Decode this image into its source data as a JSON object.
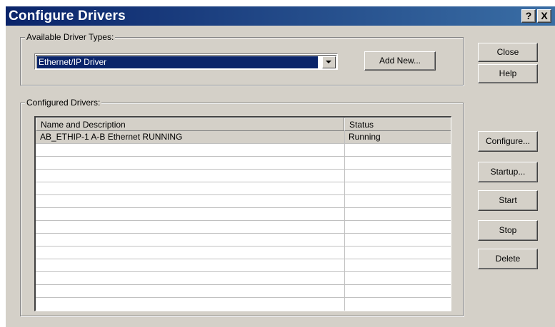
{
  "window": {
    "title": "Configure Drivers",
    "help_button": "?",
    "close_button": "X"
  },
  "available_group": {
    "label": "Available Driver Types:",
    "selected_driver": "Ethernet/IP Driver",
    "add_new_label": "Add New..."
  },
  "configured_group": {
    "label": "Configured Drivers:",
    "columns": [
      "Name and Description",
      "Status"
    ],
    "rows": [
      {
        "name": "AB_ETHIP-1  A-B Ethernet  RUNNING",
        "status": "Running"
      },
      {
        "name": "",
        "status": ""
      },
      {
        "name": "",
        "status": ""
      },
      {
        "name": "",
        "status": ""
      },
      {
        "name": "",
        "status": ""
      },
      {
        "name": "",
        "status": ""
      },
      {
        "name": "",
        "status": ""
      },
      {
        "name": "",
        "status": ""
      },
      {
        "name": "",
        "status": ""
      },
      {
        "name": "",
        "status": ""
      },
      {
        "name": "",
        "status": ""
      },
      {
        "name": "",
        "status": ""
      },
      {
        "name": "",
        "status": ""
      }
    ]
  },
  "side_buttons": {
    "close": "Close",
    "help": "Help",
    "configure": "Configure...",
    "startup": "Startup...",
    "start": "Start",
    "stop": "Stop",
    "delete": "Delete"
  },
  "colors": {
    "title_bar": "#0a246a",
    "dialog_face": "#d4d0c8",
    "selection": "#0a246a"
  }
}
